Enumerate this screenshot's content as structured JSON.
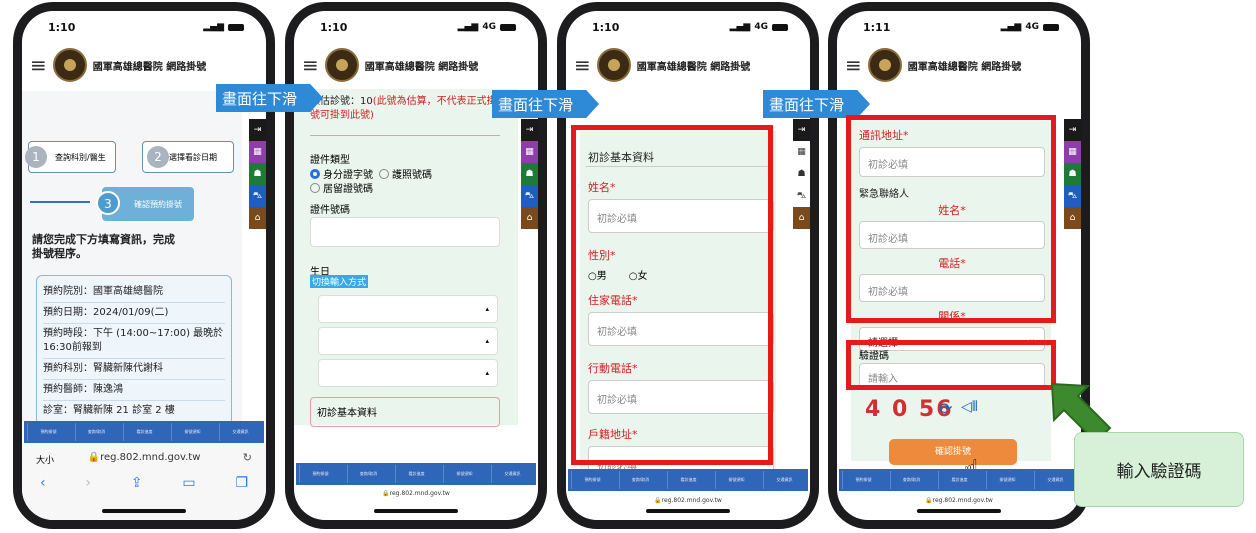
{
  "status": {
    "p1_time": "1:10",
    "p2_time": "1:10",
    "p3_time": "1:10",
    "p4_time": "1:11",
    "signal": "4G"
  },
  "header_title": "國軍高雄總醫院 網路掛號",
  "scroll_label": "畫面往下滑",
  "callout": "輸入驗證碼",
  "tabbar": [
    "預約掛號",
    "查詢/取消",
    "看診進度",
    "掛號須知",
    "交通資訊"
  ],
  "sidebar_icons": [
    "logout-icon",
    "calendar-icon",
    "doctor-icon",
    "car-icon",
    "home-icon"
  ],
  "p1": {
    "step1": "查詢科別/醫生",
    "step2": "選擇看診日期",
    "step3": "確認預約掛號",
    "instruction": "請您完成下方填寫資訊，完成掛號程序。",
    "info": [
      "預約院別：國軍高雄總醫院",
      "預約日期：2024/01/09(二)",
      "預約時段：下午 (14:00~17:00) 最晚於16:30前報到",
      "預約科別：腎臟新陳代謝科",
      "預約醫師：陳逸鴻",
      "診室：腎臟新陳 21 診室 2 樓"
    ],
    "text_size": "大小",
    "url": "reg.802.mnd.gov.tw"
  },
  "p2": {
    "estimate": "預估診號：10",
    "estimate_note": "(此號為估算，不代表正式掛號可掛到此號)",
    "id_type_label": "證件類型",
    "opt1": "身分證字號",
    "opt2": "護照號碼",
    "opt3": "居留證號碼",
    "id_no_label": "證件號碼",
    "dob_label": "生日",
    "dob_switch": "切換輸入方式",
    "section": "初診基本資料",
    "url": "reg.802.mnd.gov.tw"
  },
  "p3": {
    "section": "初診基本資料",
    "name": "姓名*",
    "name_ph": "初診必填",
    "sex": "性別*",
    "male": "男",
    "female": "女",
    "home_tel": "住家電話*",
    "home_ph": "初診必填",
    "mobile": "行動電話*",
    "mobile_ph": "初診必填",
    "addr": "戶籍地址*",
    "addr_ph": "初診必填",
    "url": "reg.802.mnd.gov.tw"
  },
  "p4": {
    "mail_addr": "通訊地址*",
    "mail_ph": "初診必填",
    "emergency": "緊急聯絡人",
    "ename": "姓名*",
    "ename_ph": "初診必填",
    "etel": "電話*",
    "etel_ph": "初診必填",
    "rel": "關係*",
    "rel_sel": "請選擇",
    "captcha_label": "驗證碼",
    "captcha_ph": "請輸入",
    "captcha": "4 0 56",
    "confirm": "確認掛號",
    "url": "reg.802.mnd.gov.tw"
  }
}
